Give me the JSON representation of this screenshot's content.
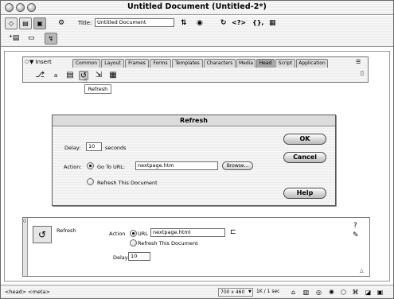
{
  "window": {
    "title": "Untitled Document (Untitled-2*)"
  },
  "doc_toolbar": {
    "title_label": "Title:",
    "title_value": "Untitled Document",
    "icons": [
      "code-view-icon",
      "split-view-icon",
      "design-view-icon",
      "site-icon",
      "file-mgmt-icon",
      "preview-icon",
      "refresh-icon",
      "code-nav-icon",
      "braces-icon",
      "view-options-icon"
    ],
    "glyph_code_nav": "<?>",
    "glyph_braces": "{},"
  },
  "insert_panel": {
    "label": "▼ Insert",
    "tabs": [
      "Common",
      "Layout",
      "Frames",
      "Forms",
      "Templates",
      "Characters",
      "Media",
      "Head",
      "Script",
      "Application"
    ],
    "active_tab": "Head",
    "icons": [
      "meta-icon",
      "keywords-icon",
      "description-icon",
      "refresh-icon",
      "base-icon",
      "link-icon"
    ],
    "tooltip": "Refresh"
  },
  "dialog": {
    "title": "Refresh",
    "delay_label": "Delay:",
    "delay_value": "10",
    "delay_unit": "seconds",
    "action_label": "Action:",
    "goto_label": "Go To URL:",
    "goto_value": "nextpage.htm",
    "browse_label": "Browse...",
    "refresh_doc_label": "Refresh This Document",
    "ok_label": "OK",
    "cancel_label": "Cancel",
    "help_label": "Help"
  },
  "inspector": {
    "title": "Refresh",
    "action_label": "Action",
    "url_label": "URL",
    "url_value": "nextpage.html",
    "refresh_doc_label": "Refresh This Document",
    "delay_label": "Delay",
    "delay_value": "10"
  },
  "statusbar": {
    "tag_selector": "<head> <meta>",
    "window_size": "700 x 460",
    "download": "1K / 1 sec"
  }
}
